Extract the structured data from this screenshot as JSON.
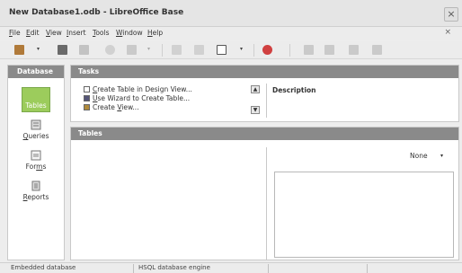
{
  "window": {
    "title": "New Database1.odb - LibreOffice Base",
    "close_glyph": "×"
  },
  "menubar": {
    "items": [
      {
        "key": "F",
        "rest": "ile"
      },
      {
        "key": "E",
        "rest": "dit"
      },
      {
        "key": "V",
        "rest": "iew"
      },
      {
        "key": "I",
        "rest": "nsert"
      },
      {
        "key": "T",
        "rest": "ools"
      },
      {
        "key": "W",
        "rest": "indow"
      },
      {
        "key": "H",
        "rest": "elp"
      }
    ],
    "close_glyph": "×"
  },
  "toolbar": {
    "icons": [
      "new-document-icon",
      "open-folder-icon",
      "save-icon",
      "copy-icon",
      "paste-icon",
      "sort-ascending-icon",
      "sort-descending-icon",
      "form-view-icon",
      "help-lifebuoy-icon",
      "table-icon",
      "form-icon",
      "report-icon",
      "query-icon"
    ]
  },
  "left_panel": {
    "header": "Database",
    "items": [
      {
        "label": "Tables",
        "selected": true
      },
      {
        "label": "Queries",
        "key": "Q",
        "rest": "ueries"
      },
      {
        "label": "Forms",
        "pre": "For",
        "key": "m",
        "rest": "s"
      },
      {
        "label": "Reports",
        "key": "R",
        "rest": "eports"
      }
    ]
  },
  "tasks": {
    "header": "Tasks",
    "items": [
      {
        "key": "C",
        "rest": "reate Table in Design View..."
      },
      {
        "key": "U",
        "rest": "se Wizard to Create Table..."
      },
      {
        "pre": "Create ",
        "key": "V",
        "rest": "iew..."
      }
    ],
    "description_label": "Description"
  },
  "tables": {
    "header": "Tables",
    "preview_select": "None",
    "arrow": "▾"
  },
  "statusbar": {
    "items": [
      "Embedded database",
      "HSQL database engine"
    ]
  },
  "colors": {
    "selected_bg": "#9ccc5c",
    "header_bg": "#8a8a8a"
  }
}
